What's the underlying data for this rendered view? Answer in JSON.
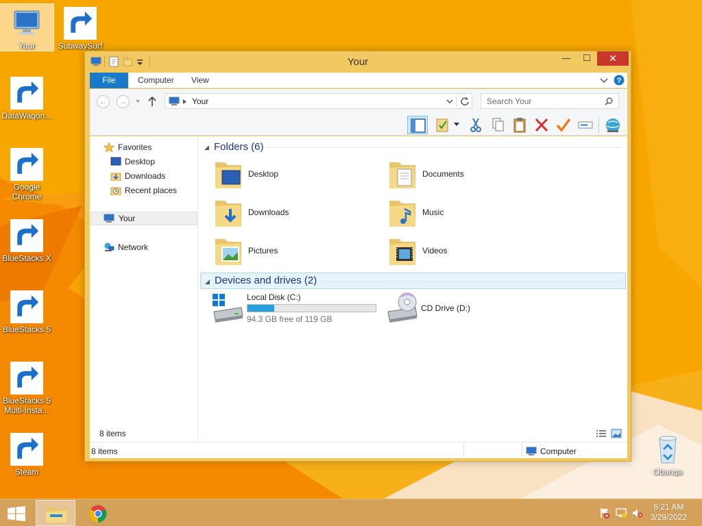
{
  "desktop": {
    "icons": [
      {
        "label": "Your",
        "icon": "computer-icon"
      },
      {
        "label": "SubwaySurf",
        "icon": "subway-surfers-icon"
      },
      {
        "label": "DataWagon...",
        "icon": "datawagon-icon"
      },
      {
        "label": "Google Chrome",
        "icon": "chrome-icon"
      },
      {
        "label": "BlueStacks X",
        "icon": "bluestacks-x-icon"
      },
      {
        "label": "BlueStacks 5",
        "icon": "bluestacks-5-icon"
      },
      {
        "label": "BlueStacks 5 Multi-Insta...",
        "icon": "bluestacks-multi-instance-icon"
      },
      {
        "label": "Steam",
        "icon": "steam-icon"
      },
      {
        "label": "Obunga",
        "icon": "recycle-bin-icon"
      }
    ]
  },
  "window": {
    "title": "Your",
    "close_glyph": "✕",
    "maximize_glyph": "☐",
    "minimize_glyph": "—",
    "ribbon_tabs": [
      "File",
      "Computer",
      "View"
    ],
    "address": {
      "breadcrumb": "Your"
    },
    "search": {
      "placeholder": "Search Your"
    },
    "toolbar_icons": [
      "preview-pane-icon",
      "properties-icon",
      "cut-icon",
      "copy-icon",
      "paste-icon",
      "delete-icon",
      "checkmark-icon",
      "rename-icon",
      "network-globe-icon"
    ]
  },
  "nav_pane": {
    "favorites_label": "Favorites",
    "favorites": [
      "Desktop",
      "Downloads",
      "Recent places"
    ],
    "this_pc_label": "Your",
    "network_label": "Network"
  },
  "content": {
    "folders_header": "Folders (6)",
    "folders": [
      "Desktop",
      "Documents",
      "Downloads",
      "Music",
      "Pictures",
      "Videos"
    ],
    "drives_header": "Devices and drives (2)",
    "drives": [
      {
        "name": "Local Disk (C:)",
        "free_text": "94.3 GB free of 119 GB",
        "used_fraction": 0.21
      },
      {
        "name": "CD Drive (D:)"
      }
    ],
    "items_count": "8 items"
  },
  "status_bar": {
    "left": "8 items",
    "right": "Computer"
  },
  "taskbar": {
    "time": "6:21 AM",
    "date": "3/29/2022"
  },
  "colors": {
    "desktop_orange": "#f7a800",
    "window_frame": "#f2c860",
    "file_tab_blue": "#1979ca",
    "close_red": "#c7382b",
    "drive_bar": "#26a0da",
    "taskbar": "#d4a15a"
  }
}
